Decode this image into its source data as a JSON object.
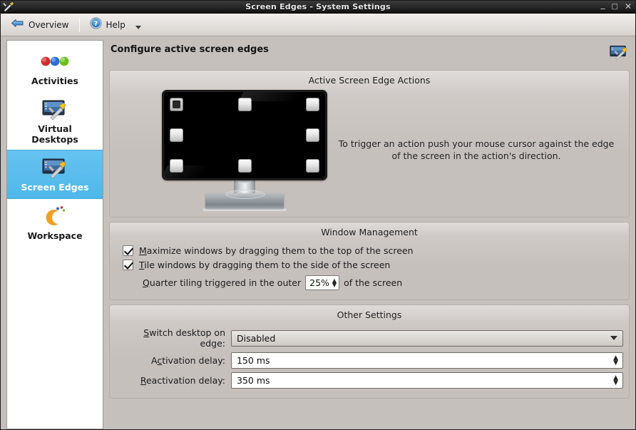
{
  "titlebar": {
    "title": "Screen Edges - System Settings",
    "icon": "tools-icon",
    "minimize_label": "_",
    "maximize_label": "□",
    "close_label": "✕"
  },
  "toolbar": {
    "overview_label": "Overview",
    "overview_icon": "back-arrow-icon",
    "help_label": "Help",
    "help_icon": "help-circle-icon",
    "dropdown_icon": "chevron-down-icon"
  },
  "sidebar": {
    "items": [
      {
        "label": "Activities",
        "icon": "activities-dots-icon",
        "selected": false
      },
      {
        "label": "Virtual\nDesktops",
        "label_line1": "Virtual",
        "label_line2": "Desktops",
        "icon": "monitor-tools-icon",
        "selected": false
      },
      {
        "label": "Screen Edges",
        "icon": "monitor-tools-icon",
        "selected": true
      },
      {
        "label": "Workspace",
        "icon": "workspace-moon-icon",
        "selected": false
      }
    ],
    "selected_color": "#4fb7ea"
  },
  "main": {
    "title": "Configure active screen edges",
    "header_icon": "monitor-tools-icon",
    "screen_edges_group": {
      "title": "Active Screen Edge Actions",
      "hint": "To trigger an action push your mouse cursor against the edge of the screen in the action's direction.",
      "edges": [
        {
          "position": "top-left",
          "active": true
        },
        {
          "position": "top-center",
          "active": false
        },
        {
          "position": "top-right",
          "active": false
        },
        {
          "position": "middle-left",
          "active": false
        },
        {
          "position": "middle-right",
          "active": false
        },
        {
          "position": "bottom-left",
          "active": false
        },
        {
          "position": "bottom-center",
          "active": false
        },
        {
          "position": "bottom-right",
          "active": false
        }
      ]
    },
    "window_management": {
      "title": "Window Management",
      "maximize": {
        "checked": true,
        "mnemonic": "M",
        "rest": "aximize windows by dragging them to the top of the screen"
      },
      "tile": {
        "checked": true,
        "mnemonic": "T",
        "rest": "ile windows by dragging them to the side of the screen"
      },
      "quarter": {
        "mnemonic": "Q",
        "prefix_rest": "uarter tiling triggered in the outer",
        "value": "25%",
        "suffix": "of the screen"
      }
    },
    "other_settings": {
      "title": "Other Settings",
      "switch_desktop": {
        "mnemonic": "S",
        "label_rest": "witch desktop on edge:",
        "value": "Disabled"
      },
      "activation_delay": {
        "prefix": "A",
        "mnemonic": "c",
        "label_rest": "tivation delay:",
        "value": "150 ms"
      },
      "reactivation_delay": {
        "mnemonic": "R",
        "label_rest": "eactivation delay:",
        "value": "350 ms"
      }
    }
  }
}
